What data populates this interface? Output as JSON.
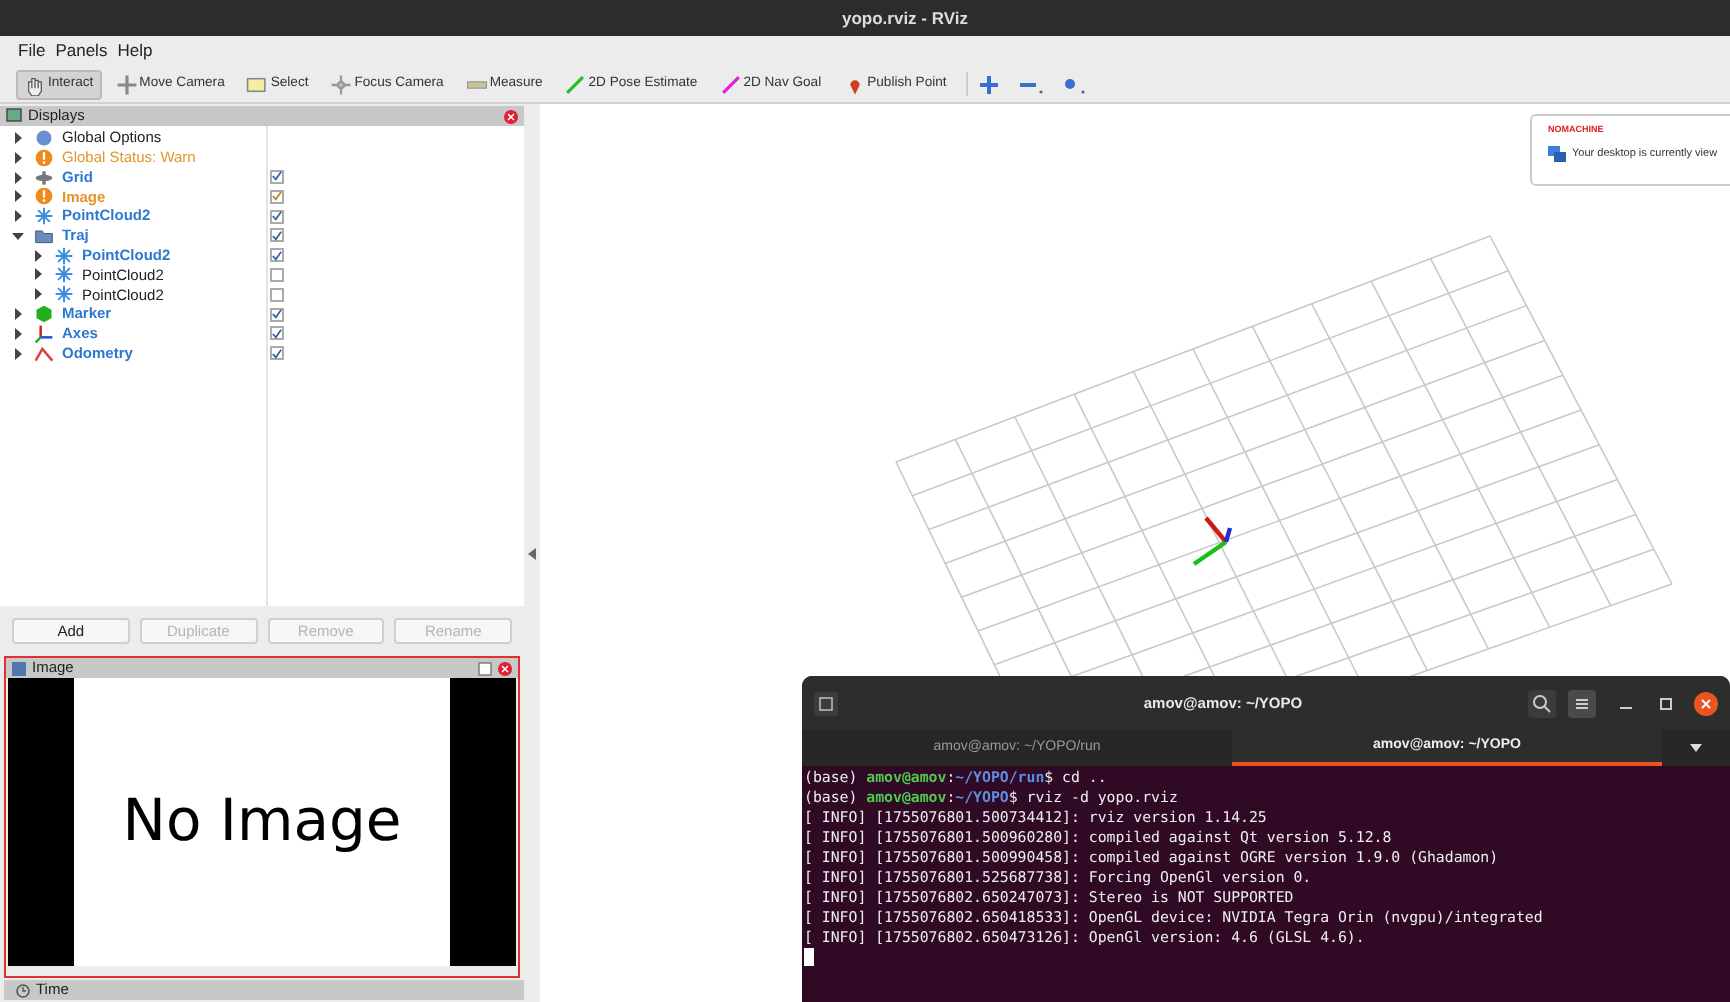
{
  "window": {
    "title": "yopo.rviz - RViz"
  },
  "menu": [
    {
      "label": "File"
    },
    {
      "label": "Panels"
    },
    {
      "label": "Help"
    }
  ],
  "toolbar": [
    {
      "label": "Interact",
      "kind": "hand",
      "selected": true
    },
    {
      "label": "Move Camera",
      "kind": "move",
      "selected": false
    },
    {
      "label": "Select",
      "kind": "select",
      "selected": false
    },
    {
      "label": "Focus Camera",
      "kind": "focus",
      "selected": false
    },
    {
      "label": "Measure",
      "kind": "measure",
      "selected": false
    },
    {
      "label": "2D Pose Estimate",
      "kind": "pose",
      "selected": false
    },
    {
      "label": "2D Nav Goal",
      "kind": "goal",
      "selected": false
    },
    {
      "label": "Publish Point",
      "kind": "pin",
      "selected": false
    }
  ],
  "displays": {
    "title": "Displays",
    "items": [
      {
        "label": "Global Options",
        "kind": "options",
        "warning": false,
        "expanded": false
      },
      {
        "label": "Global Status: Warn",
        "kind": "warn",
        "warning": true,
        "expanded": false
      },
      {
        "label": "Grid",
        "kind": "grid",
        "warning": false,
        "checked": true,
        "expanded": false
      },
      {
        "label": "Image",
        "kind": "warn",
        "warning": true,
        "checked": true,
        "expanded": false
      },
      {
        "label": "PointCloud2",
        "kind": "points",
        "warning": false,
        "checked": true,
        "expanded": false
      },
      {
        "label": "Traj",
        "kind": "folder",
        "warning": false,
        "checked": true,
        "expanded": true,
        "children": [
          {
            "label": "PointCloud2",
            "kind": "points",
            "warning": false,
            "checked": true,
            "expanded": false
          },
          {
            "label": "PointCloud2",
            "kind": "points",
            "warning": false,
            "checked": false,
            "expanded": false
          },
          {
            "label": "PointCloud2",
            "kind": "points",
            "warning": false,
            "checked": false,
            "expanded": false
          }
        ]
      },
      {
        "label": "Marker",
        "kind": "marker",
        "warning": false,
        "checked": true,
        "expanded": false
      },
      {
        "label": "Axes",
        "kind": "axes",
        "warning": false,
        "checked": true,
        "expanded": false
      },
      {
        "label": "Odometry",
        "kind": "odometry",
        "warning": false,
        "checked": true,
        "expanded": false
      }
    ]
  },
  "buttons": [
    {
      "label": "Add",
      "disabled": false
    },
    {
      "label": "Duplicate",
      "disabled": true
    },
    {
      "label": "Remove",
      "disabled": true
    },
    {
      "label": "Rename",
      "disabled": true
    }
  ],
  "image_panel": {
    "title": "Image",
    "message": "No Image"
  },
  "time_panel": {
    "title": "Time"
  },
  "notification": {
    "brand": "NOMACHINE",
    "text": "Your desktop is currently view"
  },
  "terminal": {
    "title": "amov@amov: ~/YOPO",
    "tabs": [
      {
        "label": "amov@amov: ~/YOPO/run",
        "selected": false
      },
      {
        "label": "amov@amov: ~/YOPO",
        "selected": true
      }
    ],
    "lines": [
      {
        "kind": "prompt",
        "env": "(base) ",
        "user": "amov@amov",
        "sep": ":",
        "path": "~/YOPO/run",
        "command": "$ cd .."
      },
      {
        "kind": "prompt",
        "env": "(base) ",
        "user": "amov@amov",
        "sep": ":",
        "path": "~/YOPO",
        "command": "$ rviz -d yopo.rviz"
      },
      {
        "kind": "output",
        "text": "[ INFO] [1755076801.500734412]: rviz version 1.14.25"
      },
      {
        "kind": "output",
        "text": "[ INFO] [1755076801.500960280]: compiled against Qt version 5.12.8"
      },
      {
        "kind": "output",
        "text": "[ INFO] [1755076801.500990458]: compiled against OGRE version 1.9.0 (Ghadamon)"
      },
      {
        "kind": "output",
        "text": "[ INFO] [1755076801.525687738]: Forcing OpenGl version 0."
      },
      {
        "kind": "output",
        "text": "[ INFO] [1755076802.650247073]: Stereo is NOT SUPPORTED"
      },
      {
        "kind": "output",
        "text": "[ INFO] [1755076802.650418533]: OpenGL device: NVIDIA Tegra Orin (nvgpu)/integrated"
      },
      {
        "kind": "output",
        "text": "[ INFO] [1755076802.650473126]: OpenGl version: 4.6 (GLSL 4.6)."
      },
      {
        "kind": "cursor"
      }
    ]
  }
}
